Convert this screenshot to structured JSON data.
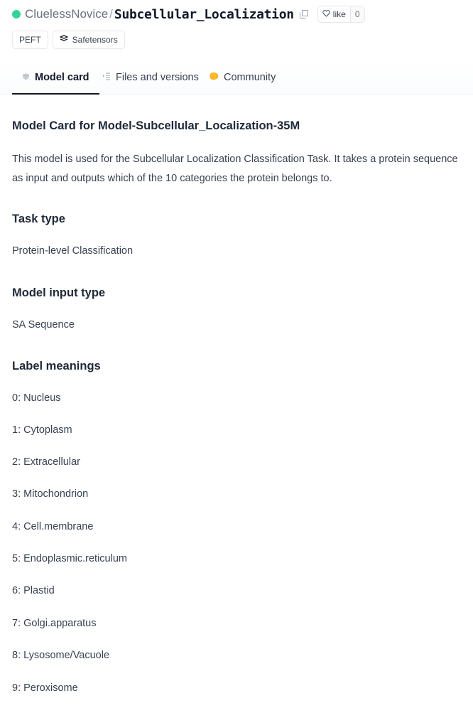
{
  "repo": {
    "owner": "CluelessNovice",
    "separator": "/",
    "name": "Subcellular_Localization",
    "like_label": "like",
    "like_count": "0"
  },
  "tags": [
    "PEFT",
    "Safetensors"
  ],
  "tabs": [
    {
      "label": "Model card",
      "active": true,
      "icon": "cube-icon"
    },
    {
      "label": "Files and versions",
      "active": false,
      "icon": "files-icon"
    },
    {
      "label": "Community",
      "active": false,
      "icon": "community-icon"
    }
  ],
  "card": {
    "title": "Model Card for Model-Subcellular_Localization-35M",
    "description": "This model is used for the Subcellular Localization Classification Task. It takes a protein sequence as input and outputs which of the 10 categories the protein belongs to.",
    "task_type_heading": "Task type",
    "task_type_value": "Protein-level Classification",
    "input_type_heading": "Model input type",
    "input_type_value": "SA Sequence",
    "label_meanings_heading": "Label meanings",
    "labels": [
      "0: Nucleus",
      "1: Cytoplasm",
      "2: Extracellular",
      "3: Mitochondrion",
      "4: Cell.membrane",
      "5: Endoplasmic.reticulum",
      "6: Plastid",
      "7: Golgi.apparatus",
      "8: Lysosome/Vacuole",
      "9: Peroxisome"
    ]
  },
  "colors": {
    "owner_dot": "#34d399",
    "community_icon": "#fbbf24"
  }
}
